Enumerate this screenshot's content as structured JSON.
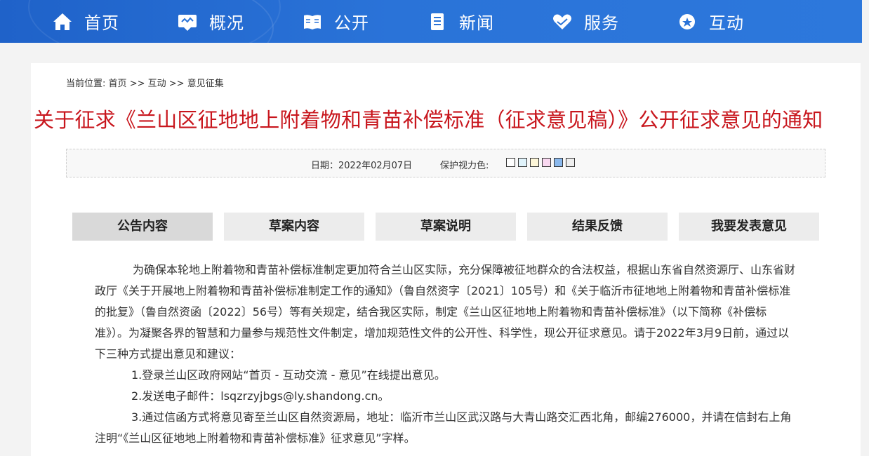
{
  "nav": {
    "items": [
      {
        "label": "首页",
        "icon": "home-icon"
      },
      {
        "label": "概况",
        "icon": "overview-icon"
      },
      {
        "label": "公开",
        "icon": "book-icon"
      },
      {
        "label": "新闻",
        "icon": "document-icon"
      },
      {
        "label": "服务",
        "icon": "heart-hand-icon"
      },
      {
        "label": "互动",
        "icon": "chat-icon"
      }
    ]
  },
  "breadcrumb": {
    "prefix": "当前位置:",
    "home": "首页",
    "sep1": ">>",
    "level1": "互动",
    "sep2": ">>",
    "level2": "意见征集"
  },
  "article": {
    "title": "关于征求《兰山区征地地上附着物和青苗补偿标准（征求意见稿）》公开征求意见的通知",
    "date": "日期：2022年02月07日",
    "protect_label": "保护视力色:"
  },
  "swatches": [
    "#ffffff",
    "#e0f3fb",
    "#fdf6d8",
    "#f9d8f0",
    "#8ab8ec",
    "#eeeeee"
  ],
  "tabs": [
    {
      "label": "公告内容",
      "active": true
    },
    {
      "label": "草案内容",
      "active": false
    },
    {
      "label": "草案说明",
      "active": false
    },
    {
      "label": "结果反馈",
      "active": false
    },
    {
      "label": "我要发表意见",
      "active": false
    }
  ],
  "body": {
    "lines": [
      "为确保本轮地上附着物和青苗补偿标准制定更加符合兰山区实际，充分保障被征地群众的合法权益，根据山东省自然资源厅、山东省财",
      "政厅《关于开展地上附着物和青苗补偿标准制定工作的通知》（鲁自然资字〔2021〕105号）和《关于临沂市征地地上附着物和青苗补偿标准",
      "的批复》（鲁自然资函〔2022〕56号）等有关规定，结合我区实际，制定《兰山区征地地上附着物和青苗补偿标准》（以下简称《补偿标",
      "准》）。为凝聚各界的智慧和力量参与规范性文件制定，增加规范性文件的公开性、科学性，现公开征求意见。请于2022年3月9日前，通过以",
      "下三种方式提出意见和建议：",
      "1.登录兰山区政府网站“首页 - 互动交流 - 意见”在线提出意见。",
      "2.发送电子邮件：lsqzrzyjbgs@ly.shandong.cn。",
      "3.通过信函方式将意见寄至兰山区自然资源局，地址：临沂市兰山区武汉路与大青山路交汇西北角，邮编276000，并请在信封右上角",
      "注明“《兰山区征地地上附着物和青苗补偿标准》征求意见”字样。"
    ]
  }
}
